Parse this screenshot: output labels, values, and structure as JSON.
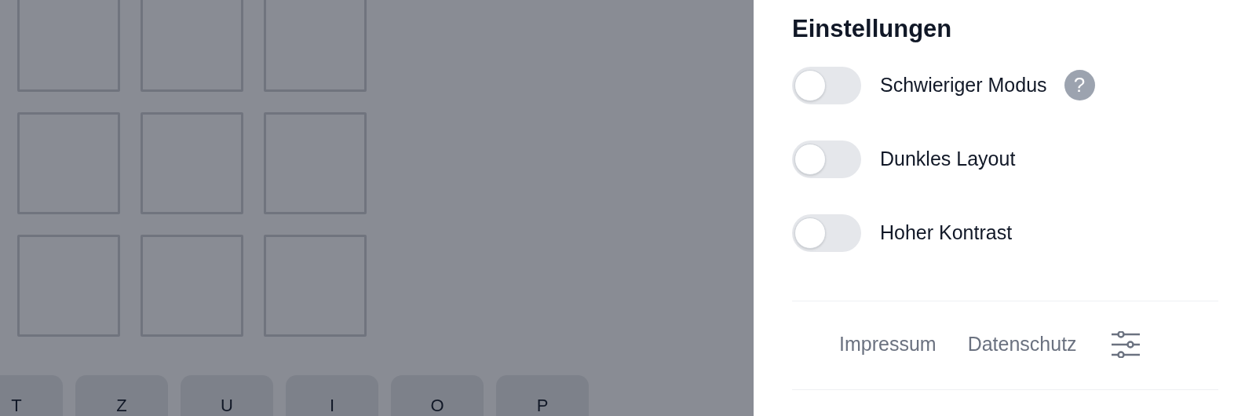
{
  "keyboard": {
    "keys": [
      {
        "label": "T"
      },
      {
        "label": "Z"
      },
      {
        "label": "U"
      },
      {
        "label": "I"
      },
      {
        "label": "O"
      },
      {
        "label": "P"
      }
    ]
  },
  "settings": {
    "title": "Einstellungen",
    "items": [
      {
        "label": "Schwieriger Modus",
        "on": false,
        "help": true
      },
      {
        "label": "Dunkles Layout",
        "on": false,
        "help": false
      },
      {
        "label": "Hoher Kontrast",
        "on": false,
        "help": false
      }
    ],
    "help_icon": "?",
    "footer_links": [
      "Impressum",
      "Datenschutz"
    ]
  }
}
